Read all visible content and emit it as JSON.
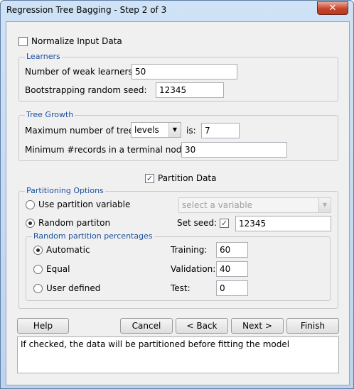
{
  "window": {
    "title": "Regression Tree Bagging - Step 2 of 3",
    "close_glyph": "✕"
  },
  "normalize": {
    "label": "Normalize Input Data",
    "checked": false
  },
  "learners": {
    "title": "Learners",
    "weak_label": "Number of weak learners:",
    "weak_value": "50",
    "seed_label": "Bootstrapping random seed:",
    "seed_value": "12345"
  },
  "tree_growth": {
    "title": "Tree Growth",
    "max_label": "Maximum number of tree:",
    "max_select": "levels",
    "is_label": "is:",
    "max_value": "7",
    "min_label": "Minimum #records in a terminal node:",
    "min_value": "30"
  },
  "partition": {
    "label": "Partition Data",
    "checked": true
  },
  "partitioning": {
    "title": "Partitioning Options",
    "use_var_label": "Use partition variable",
    "var_placeholder": "select a variable",
    "random_label": "Random partiton",
    "set_seed_label": "Set seed:",
    "seed_value": "12345",
    "percent": {
      "title": "Random partition percentages",
      "automatic": "Automatic",
      "equal": "Equal",
      "user": "User defined",
      "training_label": "Training:",
      "training_value": "60",
      "validation_label": "Validation:",
      "validation_value": "40",
      "test_label": "Test:",
      "test_value": "0"
    }
  },
  "buttons": {
    "help": "Help",
    "cancel": "Cancel",
    "back": "< Back",
    "next": "Next >",
    "finish": "Finish"
  },
  "help_text": "If checked, the data will be partitioned before fitting the model",
  "colors": {
    "group_title": "#1b4f9c",
    "title_bar": "#c5dbf2",
    "close_button": "#c7442b"
  }
}
